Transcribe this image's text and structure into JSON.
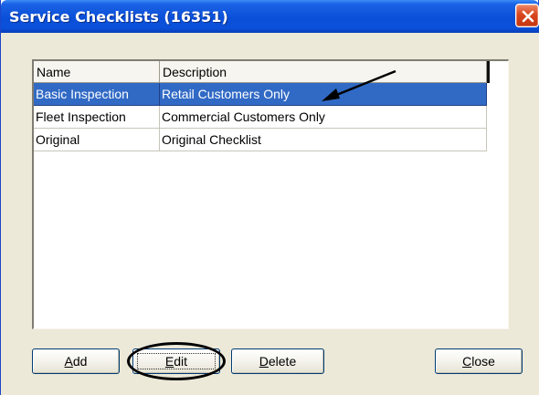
{
  "window": {
    "title": "Service Checklists (16351)"
  },
  "list": {
    "columns": [
      "Name",
      "Description"
    ],
    "rows": [
      {
        "name": "Basic Inspection",
        "description": "Retail Customers Only",
        "selected": true
      },
      {
        "name": "Fleet Inspection",
        "description": "Commercial Customers Only",
        "selected": false
      },
      {
        "name": "Original",
        "description": "Original Checklist",
        "selected": false
      }
    ]
  },
  "buttons": {
    "add": {
      "mnemonic": "A",
      "rest": "dd"
    },
    "edit": {
      "mnemonic": "E",
      "rest": "dit"
    },
    "delete": {
      "mnemonic": "D",
      "rest": "elete"
    },
    "close": {
      "mnemonic": "C",
      "rest": "lose"
    }
  },
  "colors": {
    "titlebar": "#0a4fd8",
    "selection": "#316ac5",
    "dialog_bg": "#ece9d8",
    "close_button": "#d9461f"
  },
  "icons": {
    "close": "close-x-icon"
  },
  "annotations": {
    "arrow_target_row": 0,
    "circled_button": "edit"
  }
}
